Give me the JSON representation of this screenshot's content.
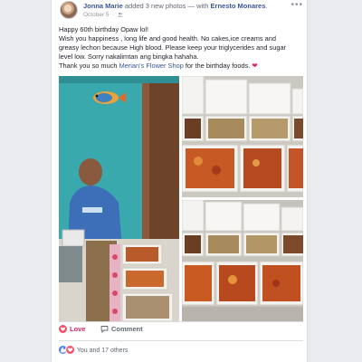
{
  "post": {
    "author": "Jonna Marie",
    "action_text": "added 3 new photos",
    "with_text": "— with",
    "tagged": "Ernesto Monares",
    "period": ".",
    "date": "October 5",
    "dot": "·",
    "more_label": "•••",
    "lines": [
      "Happy 60th birthday Opaw lol!",
      "Wish you happiness , long life and good health. No cakes,ice creams and",
      "greasy lechon because High blood. Please keep your triglycerides and sugar",
      "level low. Sorry nakalimtan ang bingka hahaha."
    ],
    "thanks_prefix": "Thank you so much ",
    "shop_link": "Merian's Flower Shop",
    "thanks_suffix": " for the birthday foods. ",
    "heart": "❤"
  },
  "photos": {
    "left_icon": "birthday-party-photo",
    "top_right_icon": "food-containers-photo",
    "bottom_right_icon": "food-containers-photo"
  },
  "actions": {
    "like_label": "Love",
    "comment_label": "Comment"
  },
  "reactions": {
    "text": "You and 17 others"
  },
  "colors": {
    "link": "#365899",
    "love": "#e0245e",
    "like_reaction": "#4f7ee8",
    "love_reaction": "#f25268"
  }
}
